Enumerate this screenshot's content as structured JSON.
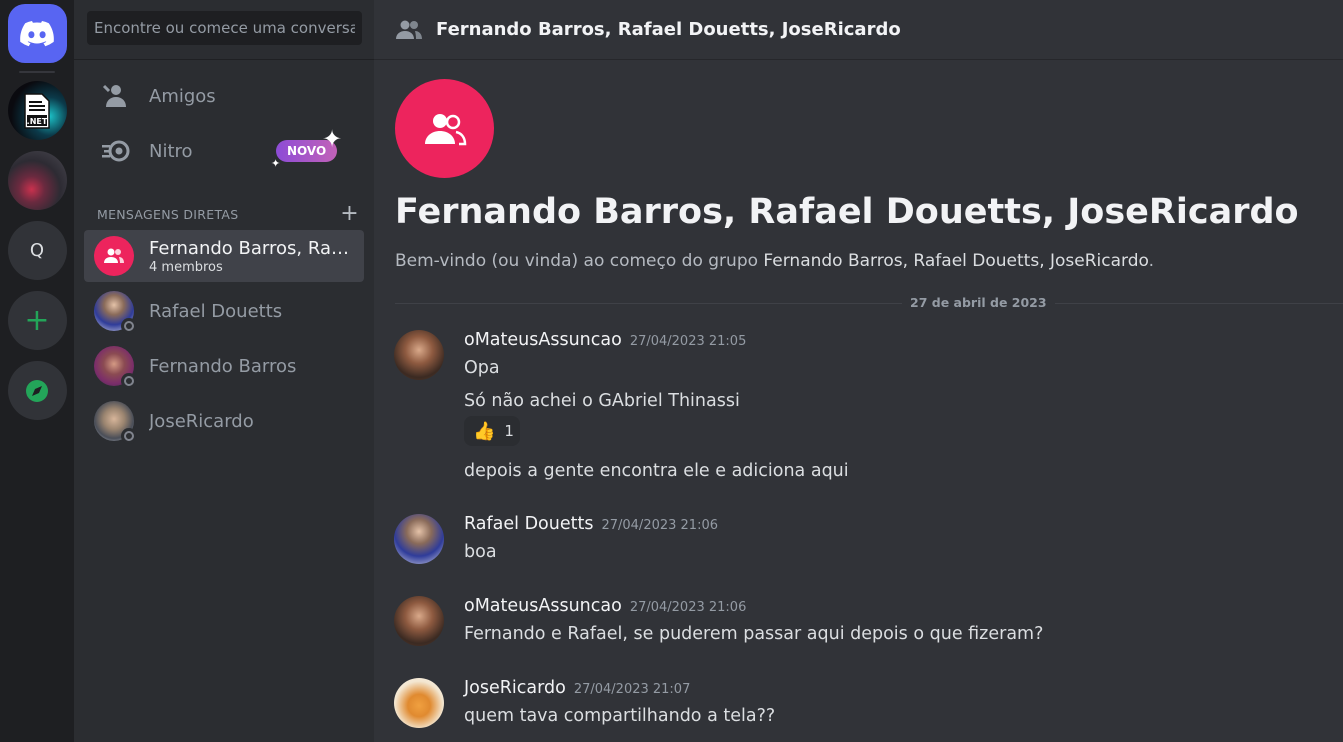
{
  "sidebar": {
    "search_placeholder": "Encontre ou comece uma conversa",
    "nav": [
      {
        "label": "Amigos",
        "icon": "friends-icon"
      },
      {
        "label": "Nitro",
        "icon": "nitro-icon",
        "badge": "NOVO"
      }
    ],
    "dm_header": "MENSAGENS DIRETAS",
    "dms": [
      {
        "name": "Fernando Barros, Rafael Douetts, JoseRicardo",
        "sub": "4 membros",
        "active": true
      },
      {
        "name": "Rafael Douetts"
      },
      {
        "name": "Fernando Barros"
      },
      {
        "name": "JoseRicardo"
      }
    ]
  },
  "rail": {
    "servers": [
      ".NET",
      "Q"
    ]
  },
  "chat": {
    "title": "Fernando Barros, Rafael Douetts, JoseRicardo",
    "welcome_title": "Fernando Barros, Rafael Douetts, JoseRicardo",
    "welcome_prefix": "Bem-vindo (ou vinda) ao começo do grupo ",
    "welcome_group": "Fernando Barros, Rafael Douetts, JoseRicardo",
    "welcome_suffix": ".",
    "date_divider": "27 de abril de 2023",
    "messages": [
      {
        "author": "oMateusAssuncao",
        "time": "27/04/2023 21:05",
        "lines": [
          "Opa",
          "Só não achei o GAbriel Thinassi",
          "depois a gente encontra ele e adiciona aqui"
        ],
        "reaction": {
          "emoji": "👍",
          "count": "1"
        }
      },
      {
        "author": "Rafael Douetts",
        "time": "27/04/2023 21:06",
        "lines": [
          "boa"
        ]
      },
      {
        "author": "oMateusAssuncao",
        "time": "27/04/2023 21:06",
        "lines": [
          "Fernando e Rafael, se puderem passar aqui depois o que fizeram?"
        ]
      },
      {
        "author": "JoseRicardo",
        "time": "27/04/2023 21:07",
        "lines": [
          "quem tava compartilhando a tela??"
        ]
      }
    ]
  },
  "colors": {
    "brand": "#5865f2",
    "group": "#ed245d",
    "online_add": "#23a559"
  }
}
